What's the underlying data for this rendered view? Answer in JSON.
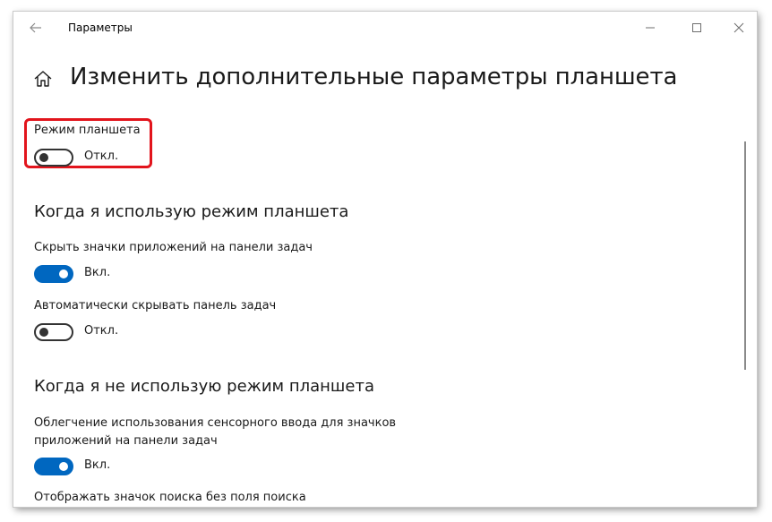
{
  "window": {
    "title": "Параметры",
    "controls": {
      "minimize": "minimize-icon",
      "maximize": "maximize-icon",
      "close": "close-icon"
    }
  },
  "header": {
    "title": "Изменить дополнительные параметры планшета",
    "home_icon": "home-icon",
    "back_icon": "back-arrow-icon"
  },
  "tablet_mode": {
    "label": "Режим планшета",
    "state": "Откл.",
    "on": false,
    "highlight_color": "#e2141c"
  },
  "section_in_tablet": {
    "title": "Когда я использую режим планшета",
    "hide_app_icons": {
      "label": "Скрыть значки приложений на панели задач",
      "state": "Вкл.",
      "on": true
    },
    "auto_hide_taskbar": {
      "label": "Автоматически скрывать панель задач",
      "state": "Откл.",
      "on": false
    }
  },
  "section_not_tablet": {
    "title": "Когда я не использую режим планшета",
    "touch_ease": {
      "label_line1": "Облегчение использования сенсорного ввода для значков",
      "label_line2": "приложений на панели задач",
      "state": "Вкл.",
      "on": true
    },
    "search_icon": {
      "label": "Отображать значок поиска без поля поиска"
    }
  },
  "colors": {
    "accent": "#0067c0",
    "toggle_off": "#333333"
  }
}
